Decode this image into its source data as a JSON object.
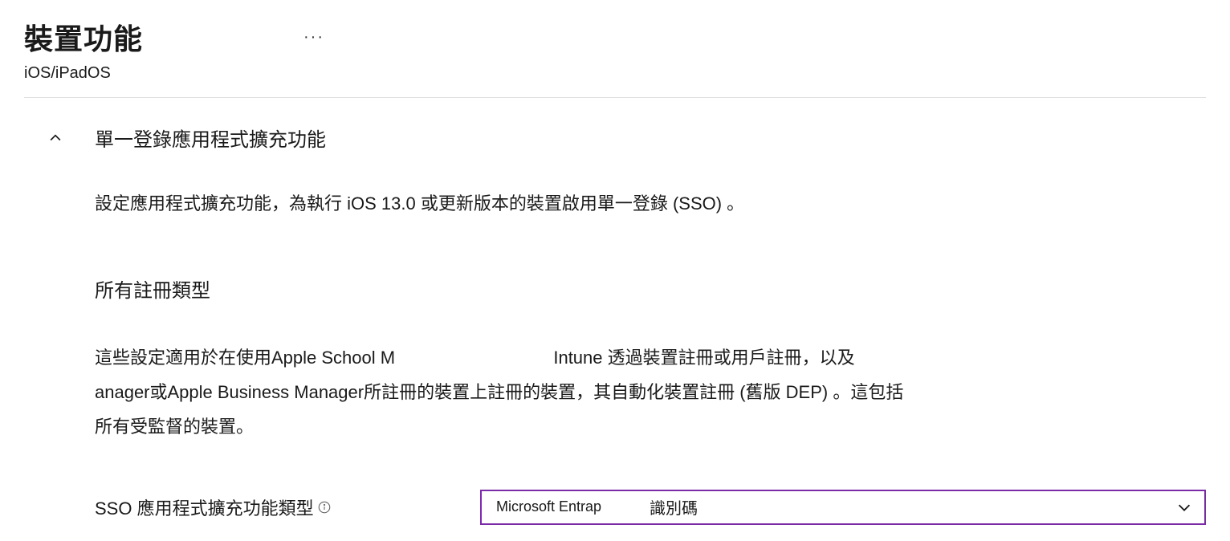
{
  "header": {
    "title": "裝置功能",
    "subtitle": "iOS/iPadOS"
  },
  "section": {
    "title": "單一登錄應用程式擴充功能",
    "description": "設定應用程式擴充功能，為執行 iOS 13.0 或更新版本的裝置啟用單一登錄 (SSO) 。",
    "subheading": "所有註冊類型",
    "body1": "這些設定適用於在使用Apple School M",
    "body2": "Intune 透過裝置註冊或用戶註冊，以及",
    "body3": "anager或Apple Business Manager所註冊的裝置上註冊的裝置，其自動化裝置註冊 (舊版 DEP) 。這包括所有受監督的裝置。"
  },
  "field": {
    "label": "SSO 應用程式擴充功能類型",
    "dropdown_value1": "Microsoft Entrap",
    "dropdown_value2": "識別碼"
  }
}
